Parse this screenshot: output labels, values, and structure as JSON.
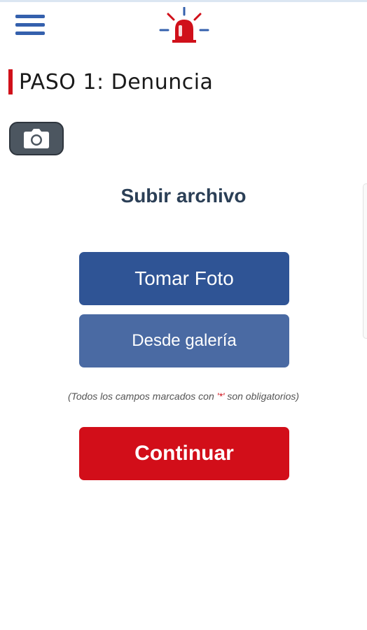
{
  "header": {
    "menu_icon": "hamburger-menu-icon",
    "logo_icon": "siren-alarm-icon",
    "colors": {
      "menu": "#3460ad",
      "siren_red": "#d0101a",
      "siren_rays": "#3460ad"
    }
  },
  "page": {
    "title": "PASO 1: Denuncia",
    "accent_color": "#d0101a"
  },
  "camera_button": {
    "icon": "camera-icon"
  },
  "upload": {
    "section_title": "Subir archivo",
    "take_photo_label": "Tomar Foto",
    "gallery_label": "Desde galería"
  },
  "note": {
    "prefix": "(Todos los campos marcados con ",
    "asterisk": "'*'",
    "suffix": " son obligatorios)"
  },
  "continue_button": {
    "label": "Continuar",
    "color": "#d20e19"
  }
}
